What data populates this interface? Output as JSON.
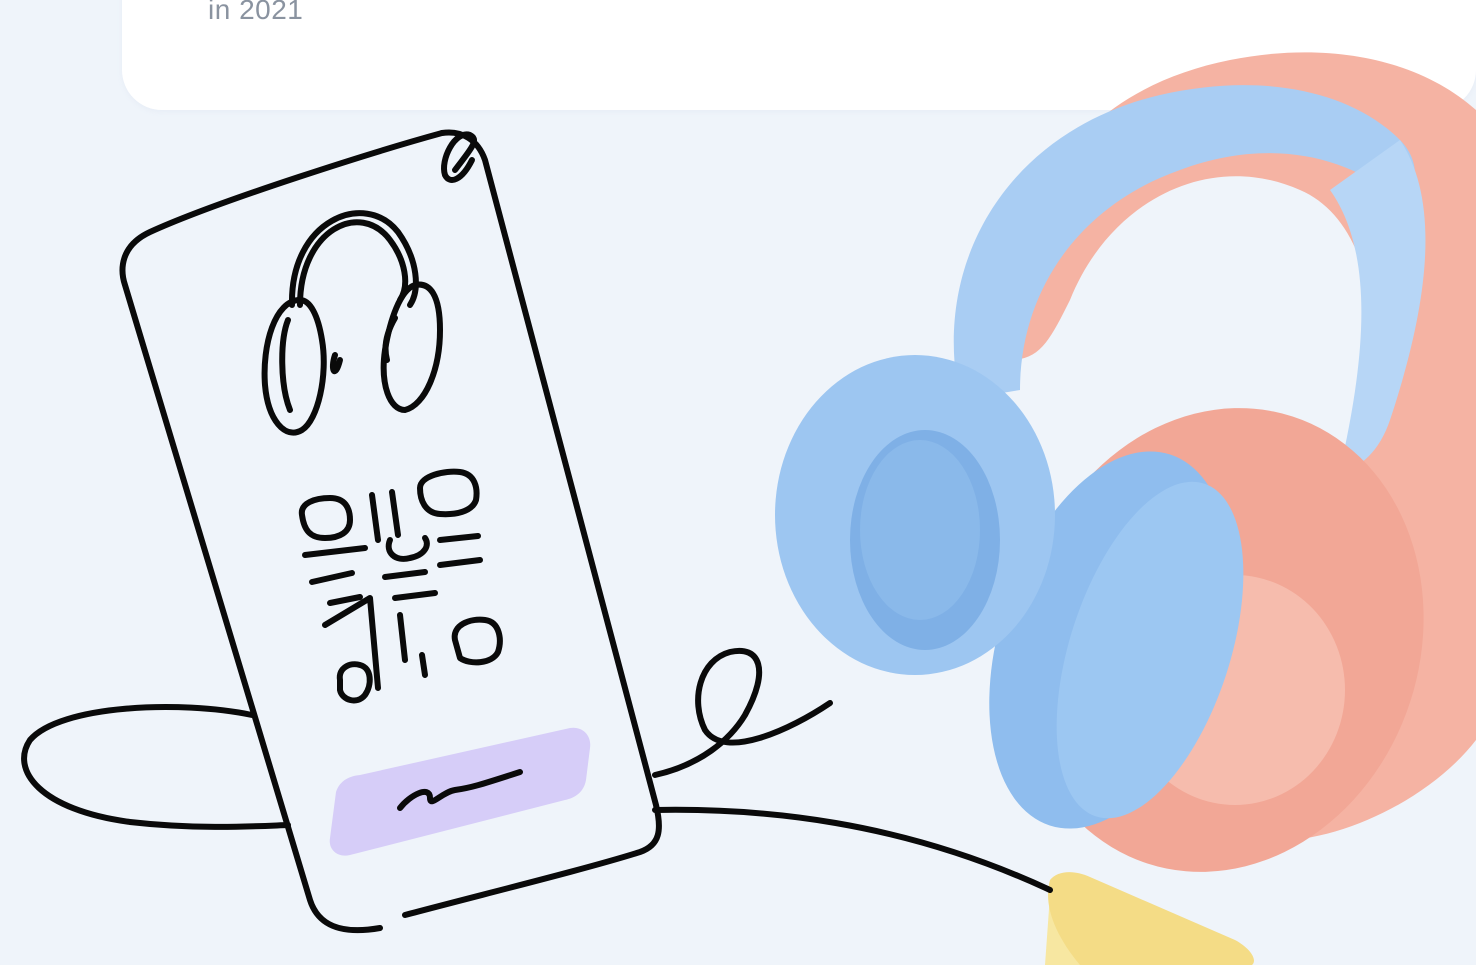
{
  "card": {
    "caption": "in 2021"
  },
  "illustration": {
    "icons": [
      "phone-doodle-icon",
      "headphones-doodle-icon",
      "qr-code-doodle-icon",
      "signature-button-icon",
      "headphones-product-image",
      "audio-jack-icon"
    ],
    "colors": {
      "background": "#eff4fa",
      "card": "#ffffff",
      "ink": "#0a0a0a",
      "pad_blue": "#a9cdf3",
      "band_pink": "#f5b3a3",
      "button_lilac": "#d6cdf8",
      "jack_yellow": "#f7e7a1"
    }
  }
}
